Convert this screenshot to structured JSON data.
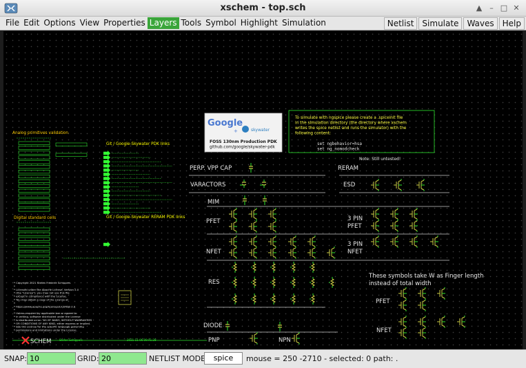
{
  "window": {
    "title": "xschem - top.sch",
    "buttons": {
      "up": "▲",
      "min": "–",
      "max": "□",
      "close": "✕"
    }
  },
  "menu": {
    "left": [
      "File",
      "Edit",
      "Options",
      "View",
      "Properties",
      "Layers",
      "Tools",
      "Symbol",
      "Highlight",
      "Simulation"
    ],
    "right": [
      "Netlist",
      "Simulate",
      "Waves",
      "Help"
    ]
  },
  "schematic": {
    "google_box": {
      "logo_word": "Google",
      "plus": "+",
      "partner": "skywater",
      "title": "FOSS 130nm Production PDK",
      "url": "github.com/google/skywater-pdk"
    },
    "sim_note": {
      "lines": [
        "To simulate with ngspice please create a .spiceinit file",
        "in the simulation directory (the directory where xschem",
        "writes the spice netlist and runs the simulator) with the",
        "following content:"
      ],
      "code": [
        "set ngbehavior=hsa",
        "set ng_nomodcheck"
      ]
    },
    "note_untested": "Note: Still untested!",
    "labels": {
      "analog": "Analog primitives validation",
      "git_links": "Git / Google-Skywater PDK links",
      "digital": "Digital standard cells",
      "reram_links": "Git / Google-Skywater RERAM PDK links",
      "perp": "PERP. VPP CAP",
      "reram": "RERAM",
      "varactors": "VARACTORS",
      "esd": "ESD",
      "mim": "MIM",
      "pfet": "PFET",
      "pin3": "3 PIN",
      "pfet2": "PFET",
      "nfet": "NFET",
      "pin3b": "3 PIN",
      "nfet2": "NFET",
      "res": "RES",
      "finger1": "These symbols take W as Finger length",
      "finger2": "instead of total width",
      "pfet3": "PFET",
      "nfet3": "NFET",
      "diode": "DIODE",
      "pnp": "PNP",
      "npn": "NPN"
    },
    "license": [
      "* Copyright 2021 Stefan Frederik Schippers",
      "*",
      "* Licensed under the Apache License, Version 2.0",
      "* (the \"License\"); you may not use this file",
      "* except in compliance with the License.",
      "* You may obtain a copy of the License at",
      "*",
      "*     https://www.apache.org/licenses/LICENSE-2.0",
      "*",
      "* Unless required by applicable law or agreed to",
      "* in writing, software distributed under the License",
      "* is distributed on an \"AS IS\" BASIS, WITHOUT WARRANTIES",
      "* OR CONDITIONS OF ANY KIND, either express or implied.",
      "* See the License for the specific language governing",
      "* permissions and limitations under the License."
    ],
    "logo": "SCHEM",
    "author": "Stefan Schippers",
    "date": "2021-11-06 09:41:28"
  },
  "statusbar": {
    "snap_label": "SNAP:",
    "snap_value": "10",
    "grid_label": "GRID:",
    "grid_value": "20",
    "netlist_label": "NETLIST MODE:",
    "netlist_value": "spice",
    "mouse_text": "mouse = 250 -2710 - selected: 0 path: ."
  },
  "colors": {
    "wire": "#2ee82e",
    "text": "#e6e6e6",
    "symbol": "#cccc44",
    "accent_yellow": "#ffff44",
    "analog_title": "#ffcc00",
    "git_title": "#ffff00"
  }
}
